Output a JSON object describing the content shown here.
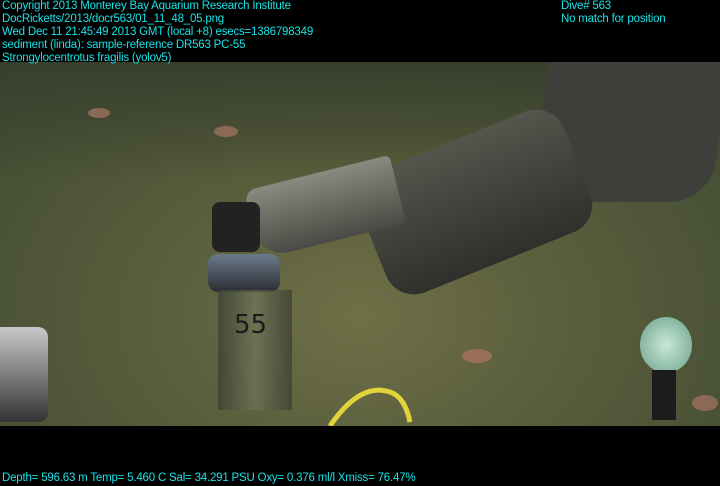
{
  "overlay": {
    "copyright": "Copyright 2013 Monterey Bay Aquarium Research Institute",
    "file_path": "DocRicketts/2013/docr563/01_11_48_05.png",
    "timestamp": "Wed Dec 11 21:45:49 2013 GMT (local +8)  esecs=1386798349",
    "annotation": "sediment (linda): sample-reference DR563 PC-55",
    "detection": "Strongylocentrotus fragilis (yolov5)",
    "dive": "Dive# 563",
    "position": "No match for position",
    "sensors": "Depth= 596.63 m  Temp= 5.460 C  Sal= 34.291 PSU  Oxy= 0.376 ml/l  Xmiss= 76.47%"
  },
  "scene": {
    "core_label": "55"
  },
  "colors": {
    "overlay_text": "#19e3e6",
    "seafloor": "#5a5e3c"
  }
}
